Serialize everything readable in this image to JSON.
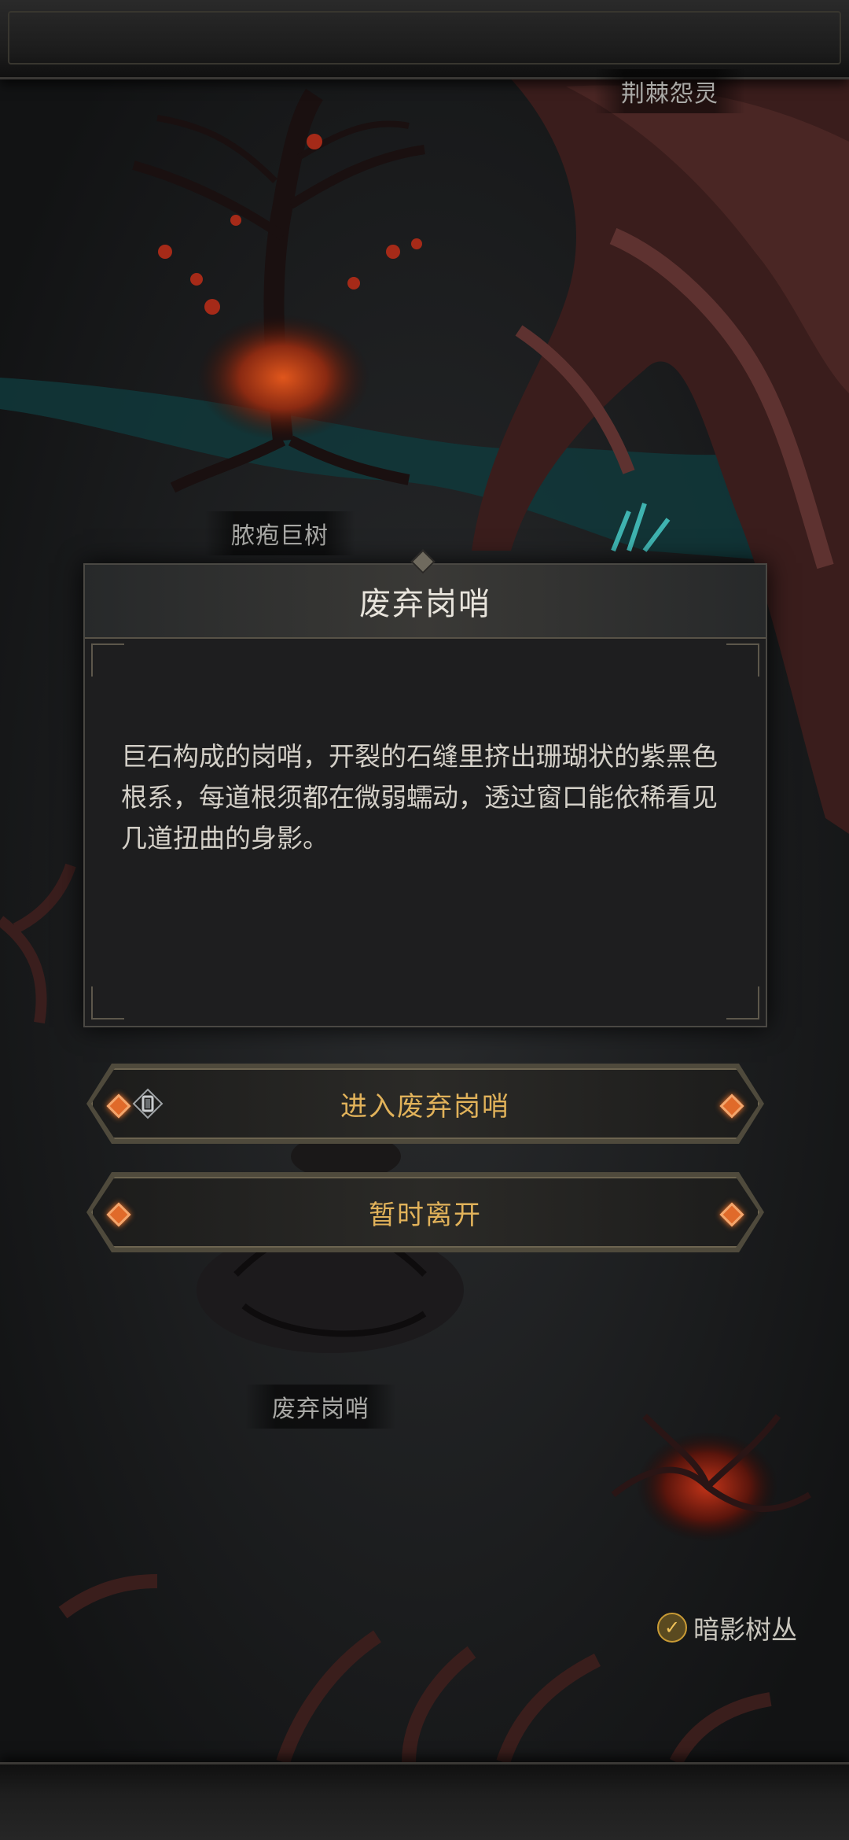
{
  "map": {
    "labels": {
      "top_right": "荆棘怨灵",
      "tree": "脓疱巨树",
      "outpost": "废弃岗哨",
      "shadow_bush": "暗影树丛"
    }
  },
  "dialog": {
    "title": "废弃岗哨",
    "description": "巨石构成的岗哨，开裂的石缝里挤出珊瑚状的紫黑色根系，每道根须都在微弱蠕动，透过窗口能依稀看见几道扭曲的身影。"
  },
  "actions": {
    "enter_label": "进入废弃岗哨",
    "leave_label": "暂时离开"
  },
  "icons": {
    "enter": "key-icon",
    "gem": "diamond-gem-icon",
    "shadow_bush_check": "check-icon"
  },
  "colors": {
    "accent_gold": "#e1b25a",
    "gem_orange": "#e06a2a",
    "panel_bg": "#1e1e1f"
  }
}
